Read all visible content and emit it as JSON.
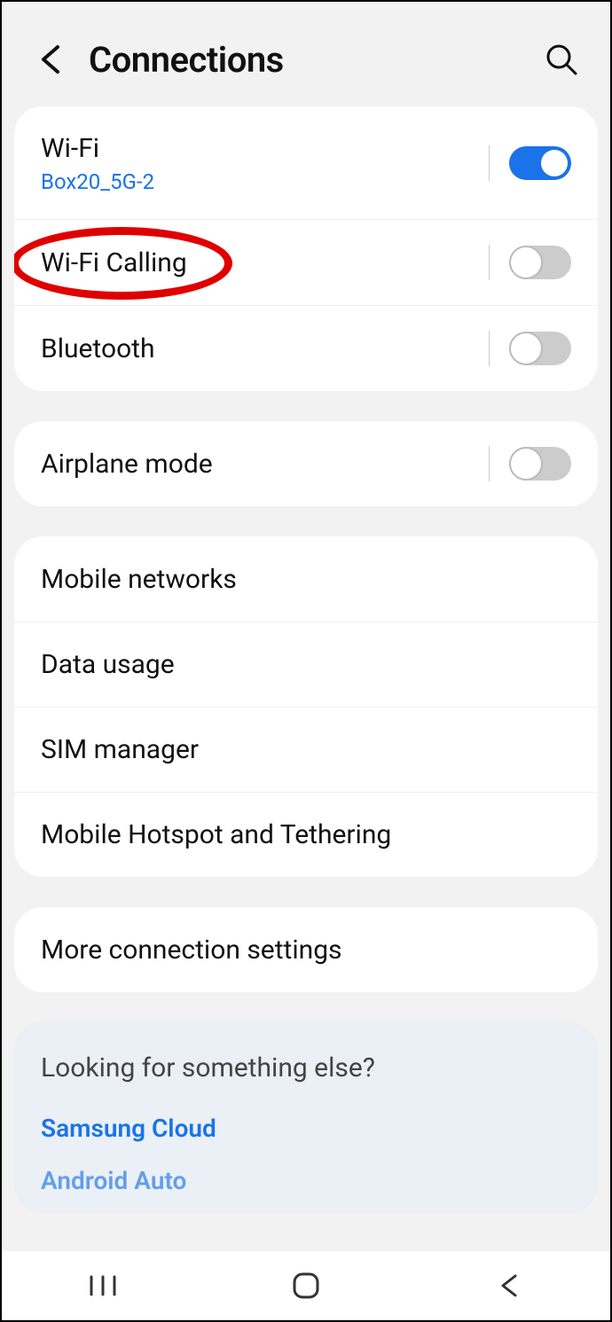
{
  "header": {
    "title": "Connections"
  },
  "groups": [
    {
      "items": [
        {
          "label": "Wi-Fi",
          "sub": "Box20_5G-2",
          "toggle": "on",
          "name": "wifi"
        },
        {
          "label": "Wi-Fi Calling",
          "toggle": "off",
          "name": "wifi-calling",
          "highlight": true
        },
        {
          "label": "Bluetooth",
          "toggle": "off",
          "name": "bluetooth"
        }
      ]
    },
    {
      "items": [
        {
          "label": "Airplane mode",
          "toggle": "off",
          "name": "airplane-mode"
        }
      ]
    },
    {
      "items": [
        {
          "label": "Mobile networks",
          "name": "mobile-networks"
        },
        {
          "label": "Data usage",
          "name": "data-usage"
        },
        {
          "label": "SIM manager",
          "name": "sim-manager"
        },
        {
          "label": "Mobile Hotspot and Tethering",
          "name": "hotspot-tethering"
        }
      ]
    },
    {
      "items": [
        {
          "label": "More connection settings",
          "name": "more-connection-settings"
        }
      ]
    }
  ],
  "suggest": {
    "title": "Looking for something else?",
    "links": [
      "Samsung Cloud",
      "Android Auto"
    ]
  }
}
